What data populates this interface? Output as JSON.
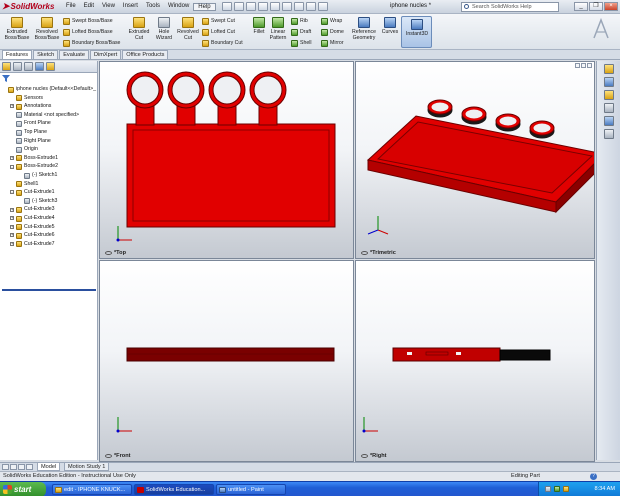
{
  "app": {
    "brand": "SolidWorks",
    "document_title": "iphone nucles *",
    "menu": [
      "File",
      "Edit",
      "View",
      "Insert",
      "Tools",
      "Window",
      "Help"
    ],
    "search_placeholder": "Search SolidWorks Help"
  },
  "ribbon": {
    "extruded_boss": "Extruded Boss/Base",
    "revolved_boss": "Revolved Boss/Base",
    "swept_boss": "Swept Boss/Base",
    "lofted_boss": "Lofted Boss/Base",
    "boundary_boss": "Boundary Boss/Base",
    "extruded_cut": "Extruded Cut",
    "hole_wizard": "Hole Wizard",
    "revolved_cut": "Revolved Cut",
    "swept_cut": "Swept Cut",
    "lofted_cut": "Lofted Cut",
    "boundary_cut": "Boundary Cut",
    "fillet": "Fillet",
    "linear_pattern": "Linear Pattern",
    "rib": "Rib",
    "draft": "Draft",
    "shell": "Shell",
    "wrap": "Wrap",
    "dome": "Dome",
    "mirror": "Mirror",
    "reference_geometry": "Reference Geometry",
    "curves": "Curves",
    "instant3d": "Instant3D"
  },
  "tabs": [
    "Features",
    "Sketch",
    "Evaluate",
    "DimXpert",
    "Office Products"
  ],
  "tree": [
    {
      "label": "iphone nucles  (Default<<Default>_",
      "indent": 0,
      "icon": "part",
      "expander": ""
    },
    {
      "label": "Sensors",
      "indent": 1,
      "icon": "folder",
      "expander": ""
    },
    {
      "label": "Annotations",
      "indent": 1,
      "icon": "annotation",
      "expander": "+"
    },
    {
      "label": "Material <not specified>",
      "indent": 1,
      "icon": "material",
      "expander": ""
    },
    {
      "label": "Front Plane",
      "indent": 1,
      "icon": "plane",
      "expander": ""
    },
    {
      "label": "Top Plane",
      "indent": 1,
      "icon": "plane",
      "expander": ""
    },
    {
      "label": "Right Plane",
      "indent": 1,
      "icon": "plane",
      "expander": ""
    },
    {
      "label": "Origin",
      "indent": 1,
      "icon": "origin",
      "expander": ""
    },
    {
      "label": "Boss-Extrude1",
      "indent": 1,
      "icon": "feature",
      "expander": "+"
    },
    {
      "label": "Boss-Extrude2",
      "indent": 1,
      "icon": "feature",
      "expander": "-"
    },
    {
      "label": "(-) Sketch1",
      "indent": 2,
      "icon": "sketch",
      "expander": ""
    },
    {
      "label": "Shell1",
      "indent": 1,
      "icon": "feature",
      "expander": ""
    },
    {
      "label": "Cut-Extrude1",
      "indent": 1,
      "icon": "cut",
      "expander": "-"
    },
    {
      "label": "(-) Sketch3",
      "indent": 2,
      "icon": "sketch",
      "expander": ""
    },
    {
      "label": "Cut-Extrude3",
      "indent": 1,
      "icon": "cut",
      "expander": "+"
    },
    {
      "label": "Cut-Extrude4",
      "indent": 1,
      "icon": "cut",
      "expander": "+"
    },
    {
      "label": "Cut-Extrude5",
      "indent": 1,
      "icon": "cut",
      "expander": "+"
    },
    {
      "label": "Cut-Extrude6",
      "indent": 1,
      "icon": "cut",
      "expander": "+"
    },
    {
      "label": "Cut-Extrude7",
      "indent": 1,
      "icon": "cut",
      "expander": "+"
    }
  ],
  "viewports": {
    "top": "*Top",
    "trimetric": "*Trimetric",
    "front": "*Front",
    "right": "*Right"
  },
  "bottom_tabs": {
    "model": "Model",
    "motion": "Motion Study 1"
  },
  "status": {
    "left": "SolidWorks Education Edition - Instructional Use Only",
    "right": "Editing Part"
  },
  "taskbar": {
    "start": "start",
    "tasks": [
      "edit - IPHONE KNUCK...",
      "SolidWorks Education...",
      "untitled - Paint"
    ],
    "clock": "8:34 AM"
  },
  "colors": {
    "part_red": "#e10000",
    "part_dark_red": "#7a0000",
    "selection_blue": "#2a4f9e"
  }
}
